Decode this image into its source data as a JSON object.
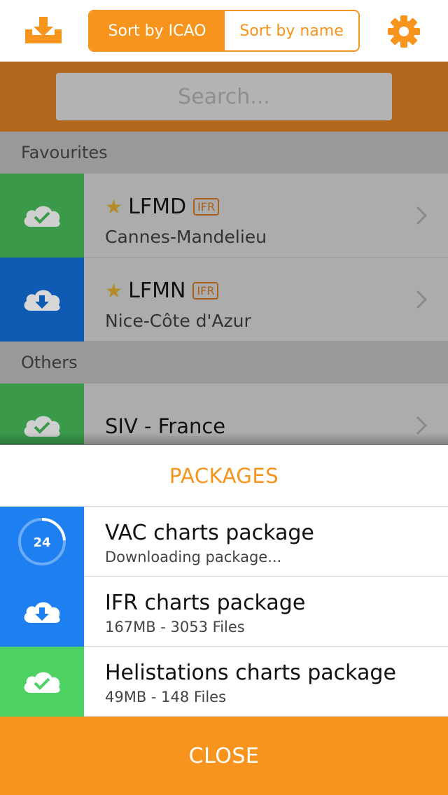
{
  "toolbar": {
    "download_icon": "tray-download-icon",
    "sort_icao_label": "Sort by ICAO",
    "sort_name_label": "Sort by name",
    "settings_icon": "gear-icon",
    "accent_color": "#f7941d"
  },
  "search": {
    "placeholder": "Search..."
  },
  "favourites": {
    "header": "Favourites",
    "items": [
      {
        "code": "LFMD",
        "badge": "IFR",
        "name": "Cannes-Mandelieu",
        "status": "downloaded",
        "status_icon": "cloud-check-icon"
      },
      {
        "code": "LFMN",
        "badge": "IFR",
        "name": "Nice-Côte d'Azur",
        "status": "not-downloaded",
        "status_icon": "cloud-download-icon"
      }
    ]
  },
  "others": {
    "header": "Others",
    "items": [
      {
        "name": "SIV - France",
        "status": "downloaded",
        "status_icon": "cloud-check-icon"
      }
    ]
  },
  "packages": {
    "title": "PACKAGES",
    "items": [
      {
        "title": "VAC charts package",
        "subtitle": "Downloading package...",
        "progress_label": "24",
        "progress_percent": 24,
        "status_icon": "progress-ring-icon"
      },
      {
        "title": "IFR charts package",
        "subtitle": "167MB - 3053 Files",
        "status_icon": "cloud-download-icon"
      },
      {
        "title": "Helistations charts package",
        "subtitle": "49MB - 148 Files",
        "status_icon": "cloud-check-icon"
      }
    ],
    "close_label": "CLOSE"
  }
}
